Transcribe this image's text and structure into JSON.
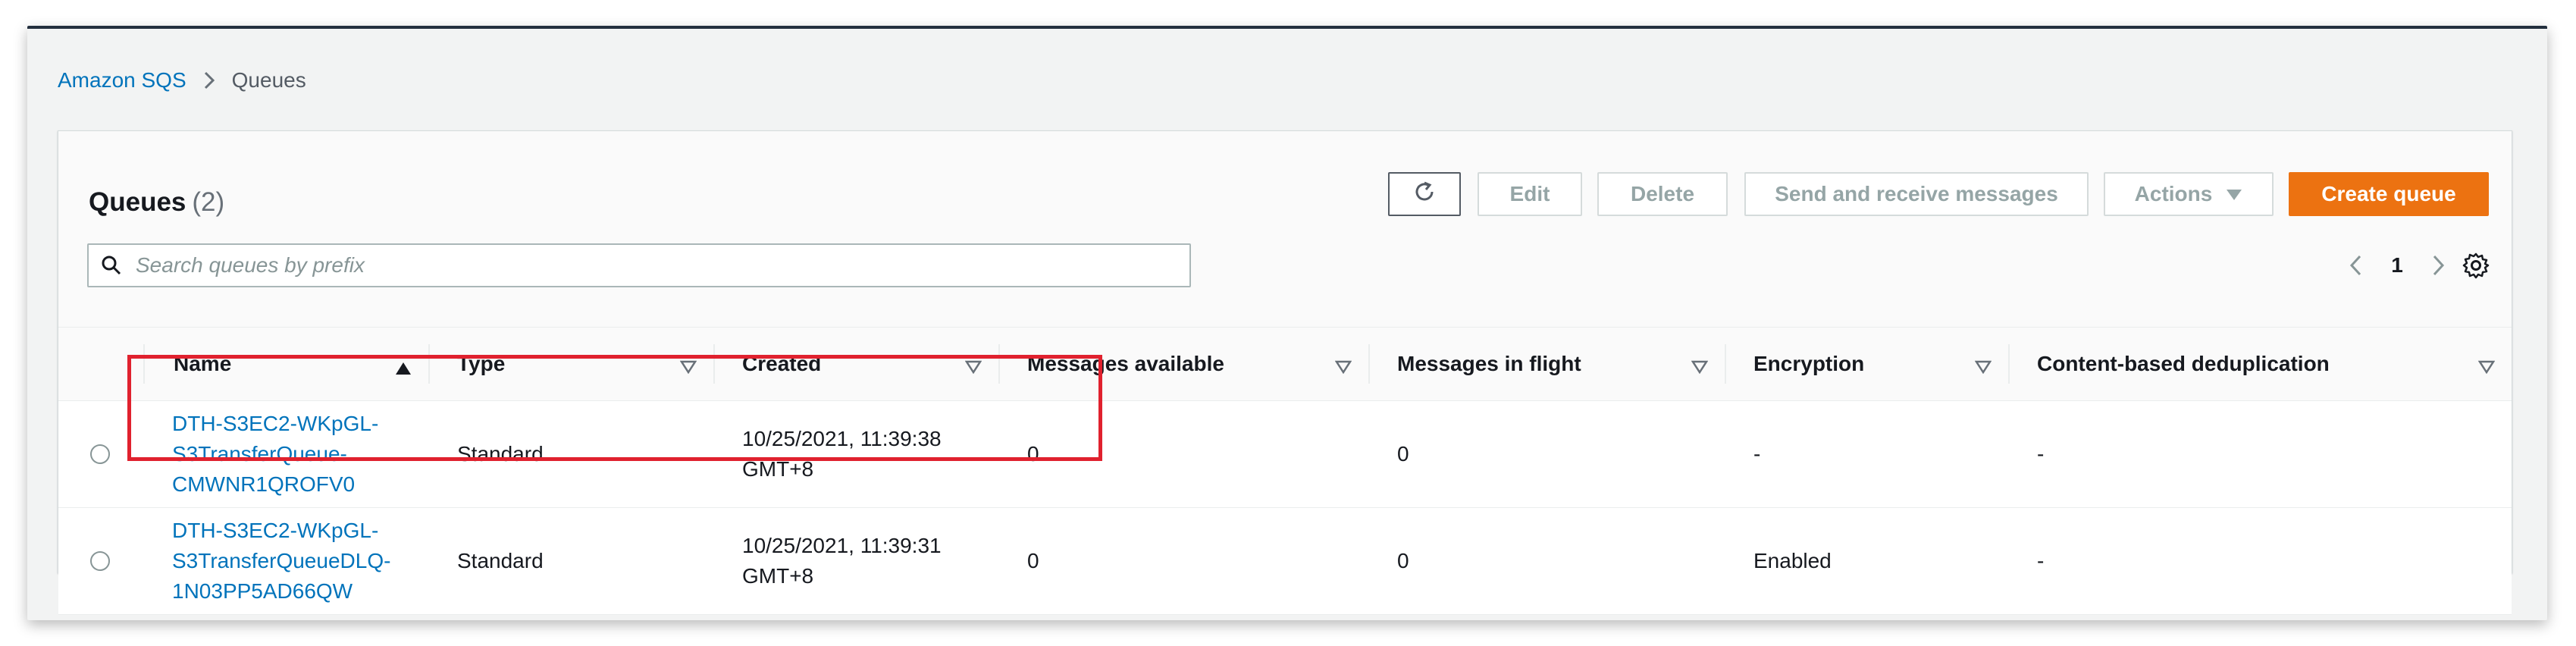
{
  "breadcrumb": {
    "root": "Amazon SQS",
    "current": "Queues"
  },
  "panel": {
    "title": "Queues",
    "count": "(2)"
  },
  "toolbar": {
    "edit_label": "Edit",
    "delete_label": "Delete",
    "send_receive_label": "Send and receive messages",
    "actions_label": "Actions",
    "create_label": "Create queue"
  },
  "search": {
    "placeholder": "Search queues by prefix",
    "value": ""
  },
  "pagination": {
    "current_page": "1"
  },
  "table": {
    "columns": {
      "name": "Name",
      "type": "Type",
      "created": "Created",
      "messages_available": "Messages available",
      "messages_in_flight": "Messages in flight",
      "encryption": "Encryption",
      "content_dedup": "Content-based deduplication"
    },
    "rows": [
      {
        "name_line1": "DTH-S3EC2-WKpGL-",
        "name_line2": "S3TransferQueue-",
        "name_line3": "CMWNR1QROFV0",
        "type": "Standard",
        "created_line1": "10/25/2021, 11:39:38",
        "created_line2": "GMT+8",
        "messages_available": "0",
        "messages_in_flight": "0",
        "encryption": "-",
        "content_dedup": "-"
      },
      {
        "name_line1": "DTH-S3EC2-WKpGL-",
        "name_line2": "S3TransferQueueDLQ-",
        "name_line3": "1N03PP5AD66QW",
        "type": "Standard",
        "created_line1": "10/25/2021, 11:39:31",
        "created_line2": "GMT+8",
        "messages_available": "0",
        "messages_in_flight": "0",
        "encryption": "Enabled",
        "content_dedup": "-"
      }
    ]
  },
  "colors": {
    "link": "#0073bb",
    "primary_button": "#ec7211",
    "highlight_box": "#e0212e"
  },
  "icons": {
    "breadcrumb_separator": "chevron-right-icon",
    "refresh": "refresh-icon",
    "actions_caret": "caret-down-icon",
    "search": "search-icon",
    "prev_page": "chevron-left-icon",
    "next_page": "chevron-right-icon",
    "settings": "gear-icon",
    "sort_asc": "sort-ascending-icon",
    "sort_filter": "sort-descending-outline-icon"
  }
}
